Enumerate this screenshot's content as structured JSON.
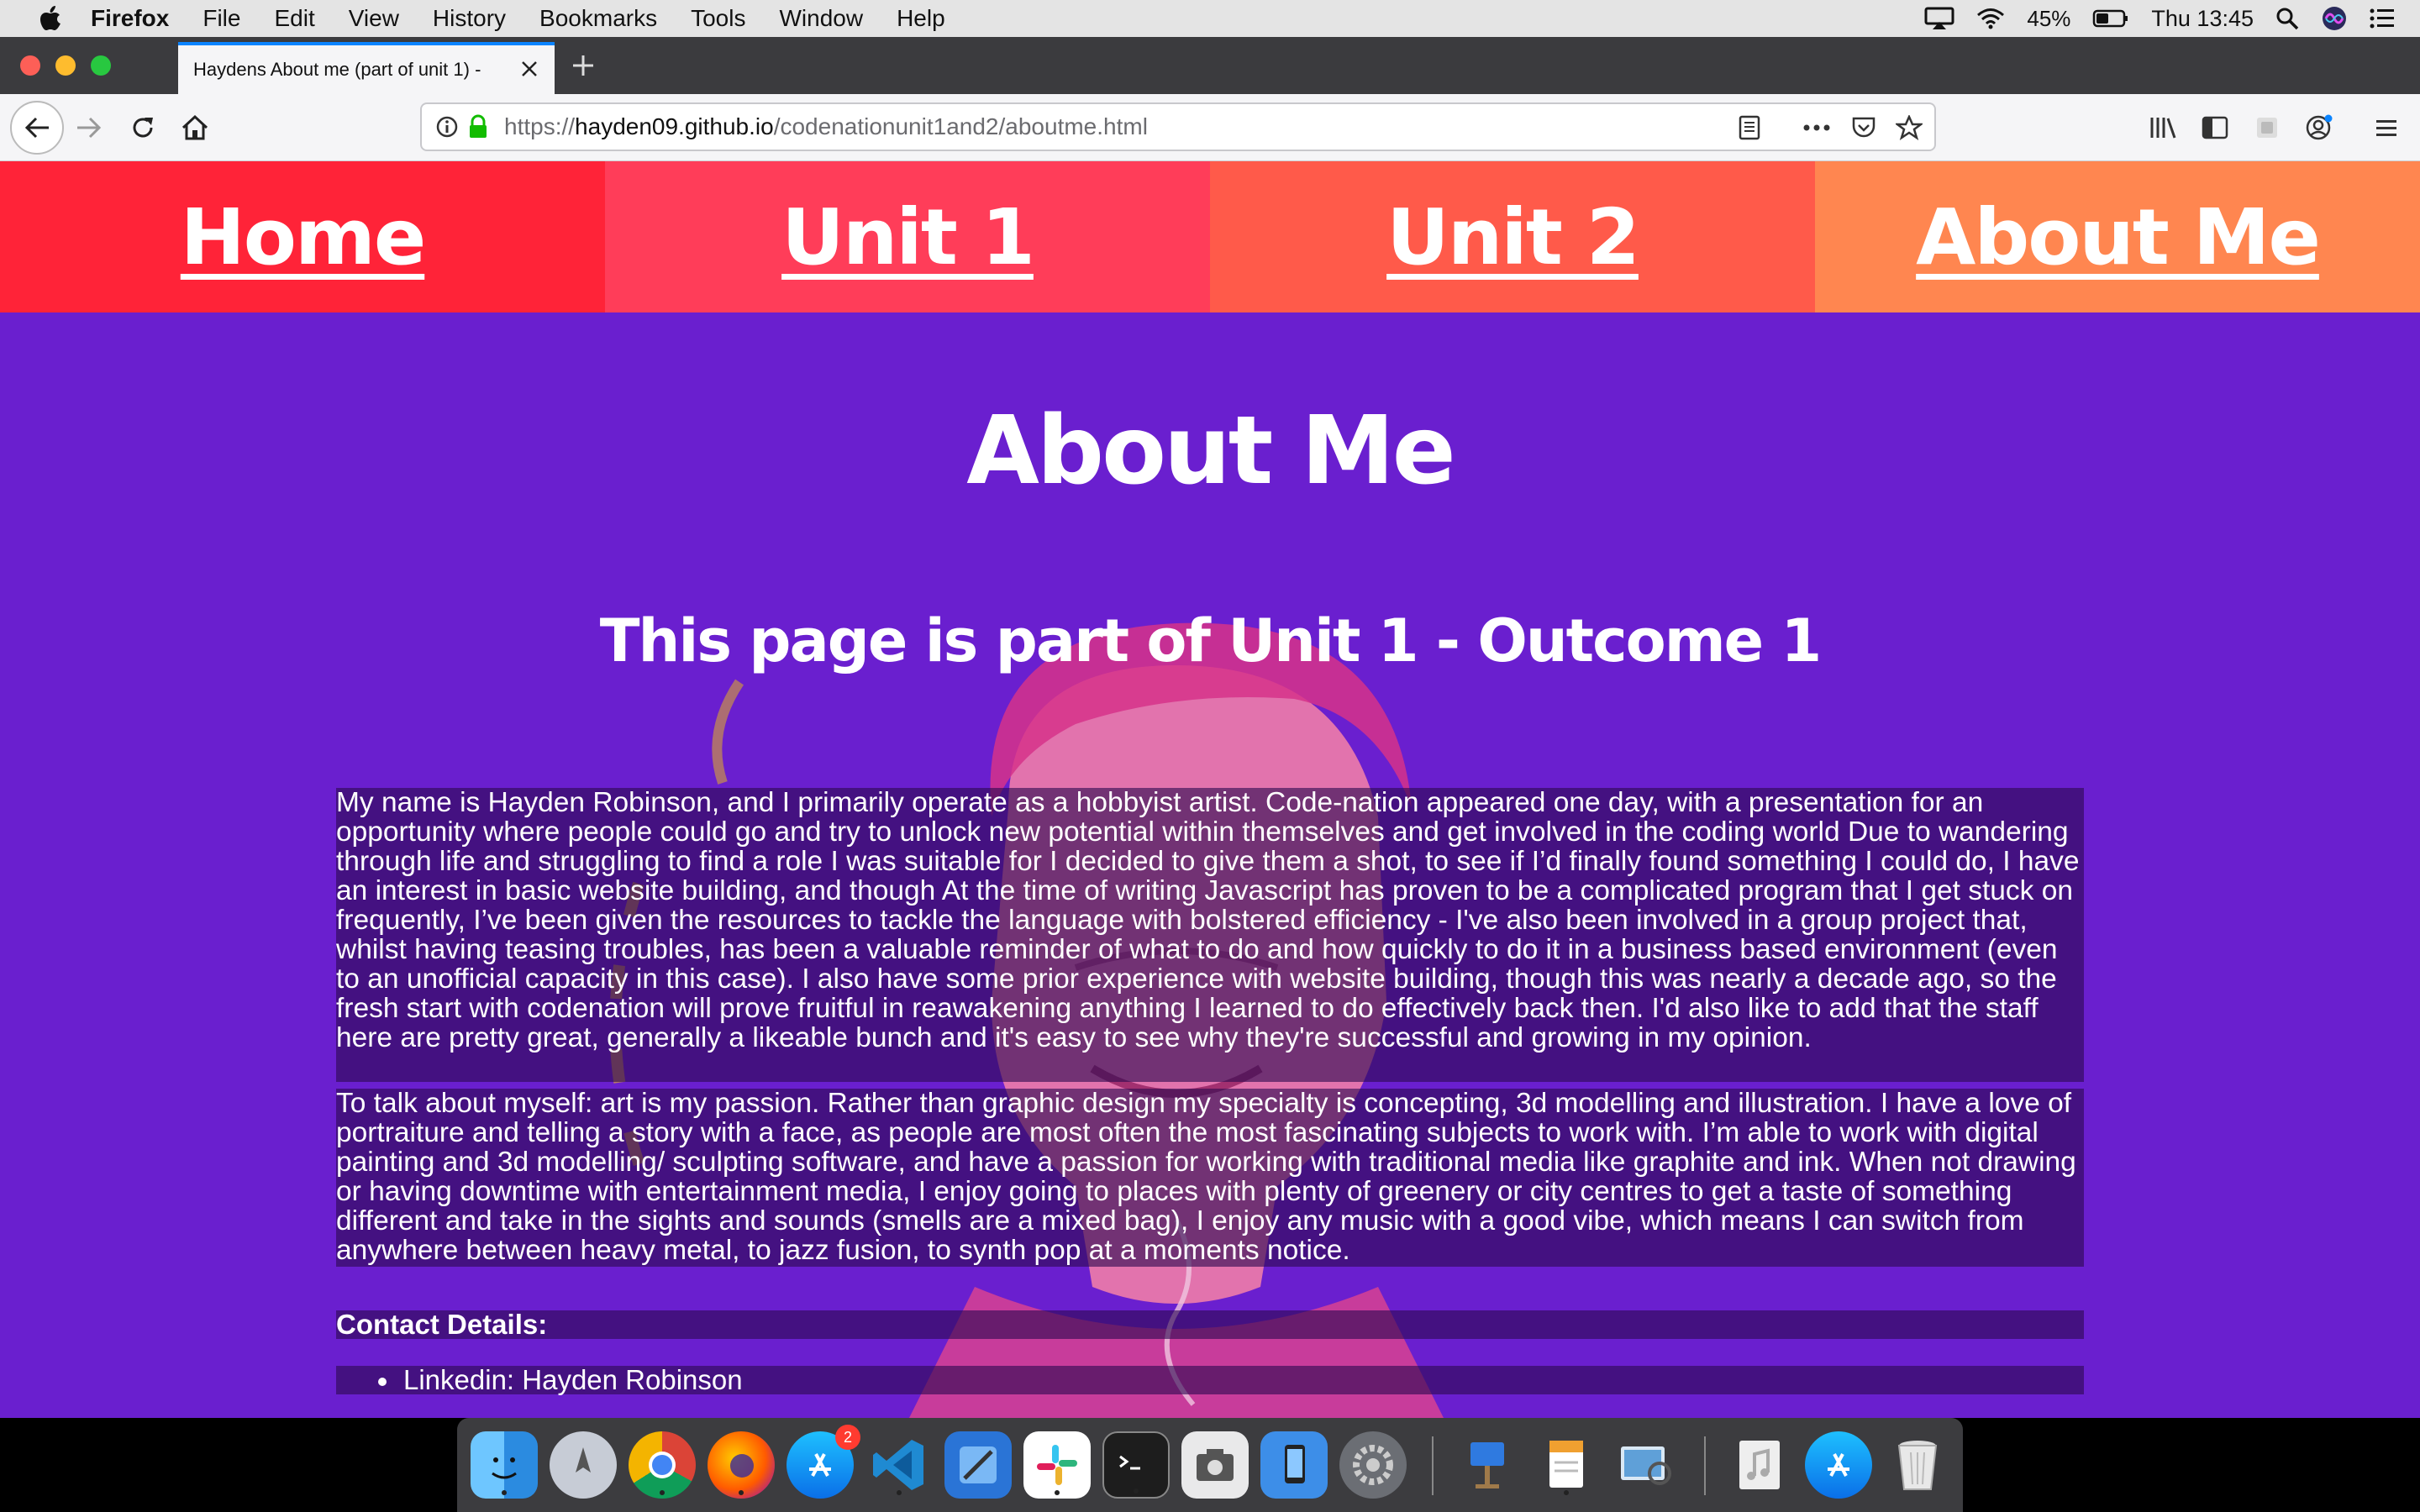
{
  "menubar": {
    "app_name": "Firefox",
    "menus": [
      "File",
      "Edit",
      "View",
      "History",
      "Bookmarks",
      "Tools",
      "Window",
      "Help"
    ],
    "battery": "45%",
    "clock": "Thu 13:45"
  },
  "browser": {
    "tab_title": "Haydens About me (part of unit 1) -",
    "url_scheme": "https://",
    "url_host": "hayden09.github.io",
    "url_path": "/codenationunit1and2/aboutme.html"
  },
  "page": {
    "nav": [
      "Home",
      "Unit 1",
      "Unit 2",
      "About Me"
    ],
    "nav_colors": [
      "#ff2338",
      "#ff3d59",
      "#ff5a4a",
      "#ff8650"
    ],
    "heading": "About Me",
    "subheading": "This page is part of Unit 1 - Outcome 1",
    "paragraph1": "My name is Hayden Robinson, and I primarily operate as a hobbyist artist. Code-nation appeared one day, with a presentation for an opportunity where people could go and try to unlock new potential within themselves and get involved in the coding world Due to wandering through life and struggling to find a role I was suitable for I decided to give them a shot, to see if I’d finally found something I could do, I have an interest in basic website building, and though At the time of writing Javascript has proven to be a complicated program that I get stuck on frequently, I’ve been given the resources to tackle the language with bolstered efficiency - I've also been involved in a group project that, whilst having teasing troubles, has been a valuable reminder of what to do and how quickly to do it in a business based environment (even to an unofficial capacity in this case). I also have some prior experience with website building, though this was nearly a decade ago, so the fresh start with codenation will prove fruitful in reawakening anything I learned to do effectively back then. I'd also like to add that the staff here are pretty great, generally a likeable bunch and it's easy to see why they're successful and growing in my opinion.",
    "paragraph2": "To talk about myself: art is my passion. Rather than graphic design my specialty is concepting, 3d modelling and illustration. I have a love of portraiture and telling a story with a face, as people are most often the most fascinating subjects to work with. I’m able to work with digital painting and 3d modelling/ sculpting software, and have a passion for working with traditional media like graphite and ink. When not drawing or having downtime with entertainment media, I enjoy going to places with plenty of greenery or city centres to get a taste of something different and take in the sights and sounds (smells are a mixed bag), I enjoy any music with a good vibe, which means I can switch from anywhere between heavy metal, to jazz fusion, to synth pop at a moments notice.",
    "contact_heading": "Contact Details:",
    "contact_items": [
      "Linkedin: Hayden Robinson"
    ],
    "background_color": "#6a1fcf"
  },
  "dock": {
    "apps": [
      "finder-icon",
      "launchpad-icon",
      "chrome-icon",
      "firefox-icon",
      "app-store-icon",
      "vscode-icon",
      "xcode-icon",
      "slack-icon",
      "terminal-icon",
      "screenshot-icon",
      "simulator-icon",
      "system-preferences-icon",
      "keynote-icon",
      "pages-icon",
      "preview-icon",
      "music-folder-icon",
      "downloads-app-store-icon",
      "trash-icon"
    ],
    "app_store_badge": "2"
  }
}
